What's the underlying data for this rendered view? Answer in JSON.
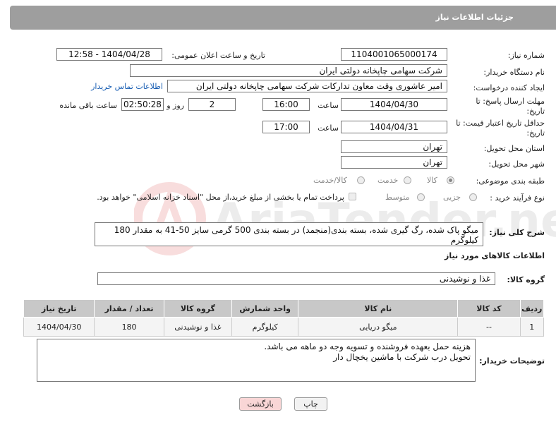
{
  "header": {
    "title": "جزئیات اطلاعات نیاز"
  },
  "fields": {
    "need_number_label": "شماره نیاز:",
    "need_number": "1104001065000174",
    "announce_label": "تاریخ و ساعت اعلان عمومی:",
    "announce_value": "1404/04/28 - 12:58",
    "buyer_label": "نام دستگاه خریدار:",
    "buyer": "شرکت سهامی چاپخانه دولتی ایران",
    "requester_label": "ایجاد کننده درخواست:",
    "requester": "امیر عاشوری وقت معاون تدارکات شرکت سهامی چاپخانه دولتی ایران",
    "contact_link": "اطلاعات تماس خریدار",
    "deadline_label": "مهلت ارسال پاسخ: تا تاریخ:",
    "deadline_date": "1404/04/30",
    "time_label": "ساعت",
    "deadline_time": "16:00",
    "days_value": "2",
    "days_label": "روز و",
    "remaining_time": "02:50:28",
    "remaining_label": "ساعت باقی مانده",
    "price_label": "حداقل تاریخ اعتبار قیمت: تا تاریخ:",
    "price_date": "1404/04/31",
    "price_time_label": "ساعت",
    "price_time": "17:00",
    "province_label": "استان محل تحویل:",
    "province": "تهران",
    "city_label": "شهر محل تحویل:",
    "city": "تهران",
    "category_label": "طبقه بندی موضوعی:",
    "category_options": [
      "کالا",
      "خدمت",
      "کالا/خدمت"
    ],
    "process_label": "نوع فرآیند خرید :",
    "process_options": [
      "جزیی",
      "متوسط"
    ],
    "payment_note": "پرداخت تمام یا بخشی از مبلغ خرید،از محل \"اسناد خزانه اسلامی\" خواهد بود.",
    "description_label": "شرح کلی نیاز:",
    "description": "میگو پاک شده، رگ گیری شده، بسته بندی(منجمد) در بسته بندی 500 گرمی سایز 50-41 به مقدار 180 کیلوگرم"
  },
  "goods": {
    "section_title": "اطلاعات کالاهای مورد نیاز",
    "group_label": "گروه کالا:",
    "group_value": "غذا و نوشیدنی",
    "columns": [
      "ردیف",
      "کد کالا",
      "نام کالا",
      "واحد شمارش",
      "گروه کالا",
      "تعداد / مقدار",
      "تاریخ نیاز"
    ],
    "rows": [
      [
        "1",
        "--",
        "میگو دریایی",
        "کیلوگرم",
        "غذا و نوشیدنی",
        "180",
        "1404/04/30"
      ]
    ]
  },
  "buyer_notes": {
    "label": "توضیحات خریدار:",
    "line1": "هزینه حمل بعهده فروشنده و تسویه وجه دو ماهه می باشد.",
    "line2": "تحویل درب شرکت با ماشین یخچال دار"
  },
  "buttons": {
    "print": "چاپ",
    "back": "بازگشت"
  },
  "watermark": {
    "text": "AriaTender.neT"
  },
  "colors": {
    "header_bg": "#9e9e9e",
    "link": "#1a5fb4",
    "back_btn_bg": "#f9d6d6"
  }
}
